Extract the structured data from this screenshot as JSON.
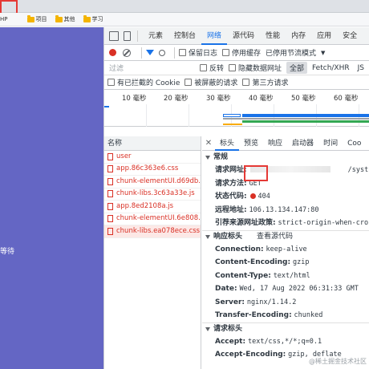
{
  "bookmarks": [
    {
      "label": "HP",
      "icon": "folder-icon"
    },
    {
      "label": "项目",
      "icon": "folder-icon"
    },
    {
      "label": "其他",
      "icon": "folder-icon"
    },
    {
      "label": "学习",
      "icon": "folder-icon"
    }
  ],
  "page": {
    "visible_text": "等待"
  },
  "devtools": {
    "tabs": [
      "元素",
      "控制台",
      "网络",
      "源代码",
      "性能",
      "内存",
      "应用",
      "安全"
    ],
    "active_tab": "网络",
    "toolbar": {
      "preserve_log": "保留日志",
      "disable_cache": "停用缓存",
      "throttling": "已停用节流模式"
    },
    "filter": {
      "placeholder": "过滤",
      "invert": "反转",
      "hide_data_urls": "隐藏数据网址",
      "types": [
        "全部",
        "Fetch/XHR",
        "JS"
      ],
      "active_type": "全部"
    },
    "blocked": {
      "blocked_cookies": "有已拦截的 Cookie",
      "blocked_requests": "被屏蔽的请求",
      "third_party": "第三方请求"
    },
    "timeline_ticks": [
      "10 毫秒",
      "20 毫秒",
      "30 毫秒",
      "40 毫秒",
      "50 毫秒",
      "60 毫秒"
    ],
    "name_header": "名称",
    "requests": [
      "user",
      "app.86c363e6.css",
      "chunk-elementUI.d69db...",
      "chunk-libs.3c63a33e.js",
      "app.8ed2108a.js",
      "chunk-elementUI.6e808...",
      "chunk-libs.ea078ece.css"
    ],
    "selected_request": "chunk-libs.ea078ece.css",
    "detail_tabs": [
      "标头",
      "预览",
      "响应",
      "启动器",
      "时间",
      "Coo"
    ],
    "active_detail_tab": "标头",
    "general": {
      "title": "常规",
      "rows": [
        {
          "k": "请求网址:",
          "v": "/syst"
        },
        {
          "k": "请求方法:",
          "v": "GET"
        },
        {
          "k": "状态代码:",
          "v": "404"
        },
        {
          "k": "远程地址:",
          "v": "106.13.134.147:80"
        },
        {
          "k": "引荐来源网址政策:",
          "v": "strict-origin-when-cross"
        }
      ]
    },
    "response_headers": {
      "title": "响应标头",
      "view_source": "查看源代码",
      "rows": [
        {
          "k": "Connection:",
          "v": "keep-alive"
        },
        {
          "k": "Content-Encoding:",
          "v": "gzip"
        },
        {
          "k": "Content-Type:",
          "v": "text/html"
        },
        {
          "k": "Date:",
          "v": "Wed, 17 Aug 2022 06:31:33 GMT"
        },
        {
          "k": "Server:",
          "v": "nginx/1.14.2"
        },
        {
          "k": "Transfer-Encoding:",
          "v": "chunked"
        }
      ]
    },
    "request_headers": {
      "title": "请求标头",
      "rows": [
        {
          "k": "Accept:",
          "v": "text/css,*/*;q=0.1"
        },
        {
          "k": "Accept-Encoding:",
          "v": "gzip, deflate"
        }
      ]
    },
    "watermark": "@稀土掘金技术社区"
  },
  "colors": {
    "page_bg": "#6466c4",
    "accent": "#1a73e8",
    "error": "#d93025"
  }
}
